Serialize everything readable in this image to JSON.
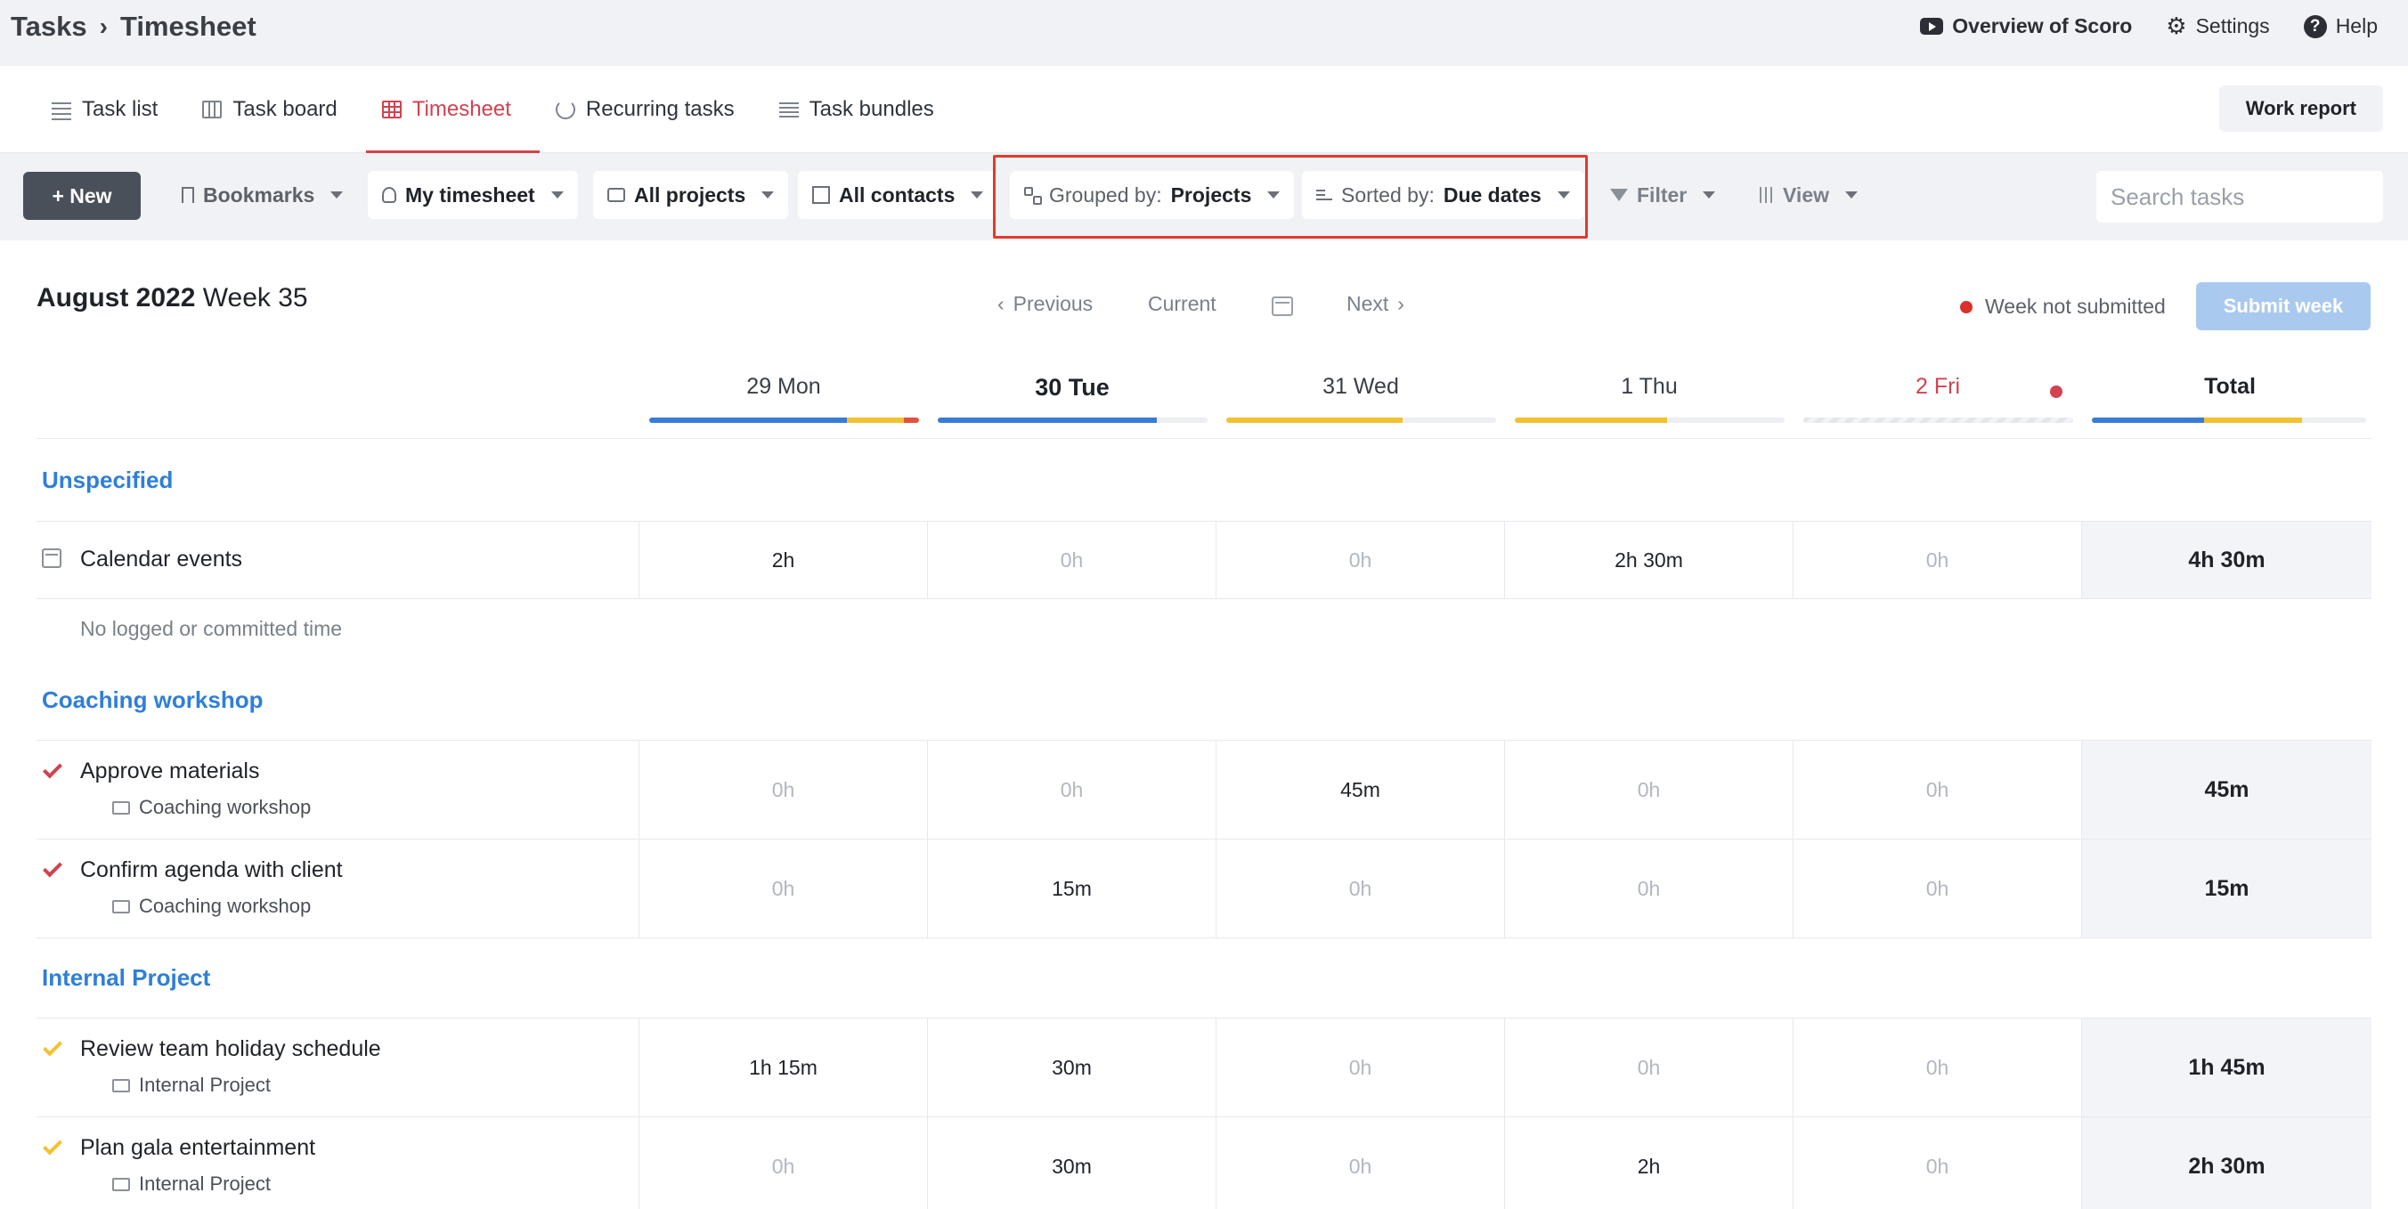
{
  "breadcrumb": {
    "root": "Tasks",
    "separator": "›",
    "current": "Timesheet"
  },
  "top_actions": {
    "overview": "Overview of Scoro",
    "settings": "Settings",
    "help": "Help",
    "help_glyph": "?"
  },
  "tabs": [
    {
      "label": "Task list",
      "icon": "list-icon",
      "active": false
    },
    {
      "label": "Task board",
      "icon": "board-icon",
      "active": false
    },
    {
      "label": "Timesheet",
      "icon": "grid-icon",
      "active": true
    },
    {
      "label": "Recurring tasks",
      "icon": "recurring-icon",
      "active": false
    },
    {
      "label": "Task bundles",
      "icon": "bundle-icon",
      "active": false
    }
  ],
  "work_report": "Work report",
  "toolbar": {
    "new_label": "+ New",
    "bookmarks": "Bookmarks",
    "my_timesheet": "My timesheet",
    "all_projects": "All projects",
    "all_contacts": "All contacts",
    "grouped_prefix": "Grouped by:",
    "grouped_value": "Projects",
    "sorted_prefix": "Sorted by:",
    "sorted_value": "Due dates",
    "filter": "Filter",
    "view": "View",
    "search_placeholder": "Search tasks"
  },
  "week": {
    "month": "August 2022",
    "week_label": "Week 35",
    "previous": "Previous",
    "current": "Current",
    "next": "Next",
    "prev_glyph": "‹",
    "next_glyph": "›",
    "status": "Week not submitted",
    "submit": "Submit week"
  },
  "columns": [
    "29 Mon",
    "30 Tue",
    "31 Wed",
    "1 Thu",
    "2 Fri",
    "Total"
  ],
  "colors": {
    "blue": "#3a7bd5",
    "yellow": "#f3c230",
    "red": "#e0533d",
    "accent": "#d2424f",
    "link": "#2f7fd8"
  },
  "groups": [
    {
      "title": "Unspecified",
      "rows": [
        {
          "name": "Calendar events",
          "icon": "calendar-icon",
          "sub": "",
          "cells": [
            "2h",
            "0h",
            "0h",
            "2h 30m",
            "0h"
          ],
          "total": "4h 30m"
        }
      ],
      "note": "No logged or committed time"
    },
    {
      "title": "Coaching workshop",
      "rows": [
        {
          "name": "Approve materials",
          "icon": "check-red-icon",
          "sub": "Coaching workshop",
          "cells": [
            "0h",
            "0h",
            "45m",
            "0h",
            "0h"
          ],
          "total": "45m"
        },
        {
          "name": "Confirm agenda with client",
          "icon": "check-red-icon",
          "sub": "Coaching workshop",
          "cells": [
            "0h",
            "15m",
            "0h",
            "0h",
            "0h"
          ],
          "total": "15m"
        }
      ]
    },
    {
      "title": "Internal Project",
      "rows": [
        {
          "name": "Review team holiday schedule",
          "icon": "check-yellow-icon",
          "sub": "Internal Project",
          "cells": [
            "1h 15m",
            "30m",
            "0h",
            "0h",
            "0h"
          ],
          "total": "1h 45m"
        },
        {
          "name": "Plan gala entertainment",
          "icon": "check-yellow-icon",
          "sub": "Internal Project",
          "cells": [
            "0h",
            "30m",
            "0h",
            "2h",
            "0h"
          ],
          "total": "2h 30m"
        }
      ]
    }
  ]
}
